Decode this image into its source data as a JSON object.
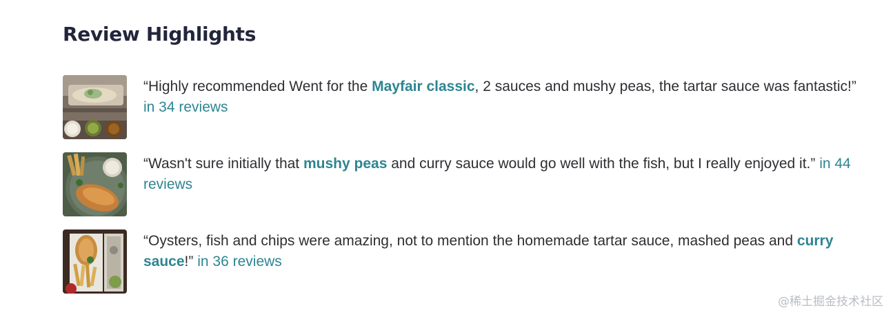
{
  "section": {
    "title": "Review Highlights"
  },
  "reviews": [
    {
      "open_quote": "“",
      "before": "Highly recommended Went for the ",
      "highlight": "Mayfair classic",
      "after": ", 2 sauces and mushy peas, the tartar sauce was fantastic!",
      "close_quote": "”",
      "count_label": "in 34 reviews",
      "thumbnail_icon": "fish-wrap-photo"
    },
    {
      "open_quote": "“",
      "before": "Wasn't sure initially that ",
      "highlight": "mushy peas",
      "after": " and curry sauce would go well with the fish, but I really enjoyed it.",
      "close_quote": "”",
      "count_label": "in 44 reviews",
      "thumbnail_icon": "fish-and-chips-plate-photo"
    },
    {
      "open_quote": "“",
      "before": "Oysters, fish and chips were amazing, not to mention the homemade tartar sauce, mashed peas and ",
      "highlight": "curry sauce",
      "after": "!",
      "close_quote": "”",
      "count_label": "in 36 reviews",
      "thumbnail_icon": "fish-and-chips-paper-photo"
    }
  ],
  "watermark": "@稀土掘金技术社区",
  "colors": {
    "heading": "#23263b",
    "text": "#2e2e33",
    "accent": "#2d8591"
  }
}
